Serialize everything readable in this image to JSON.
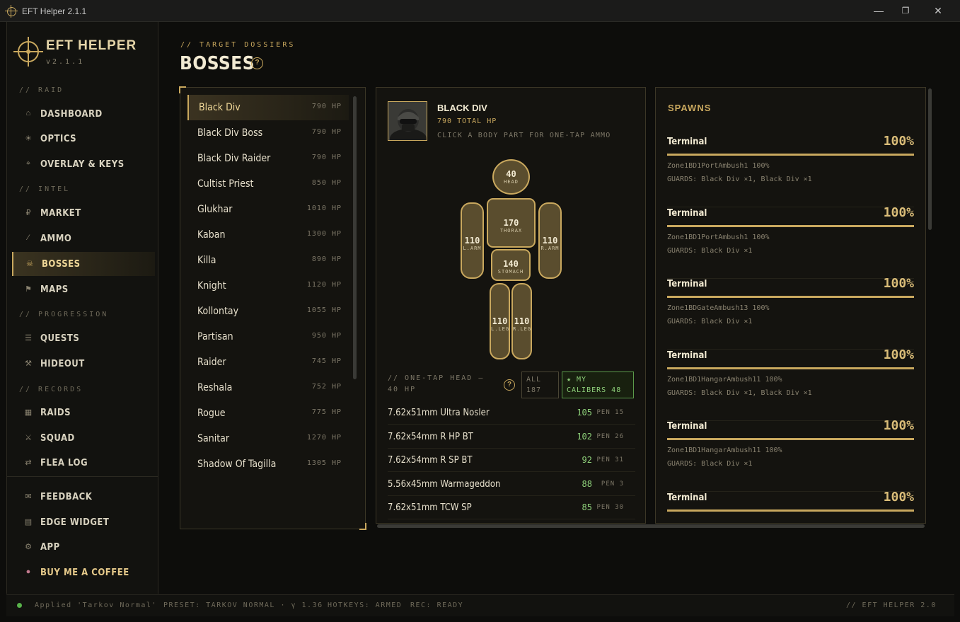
{
  "window": {
    "title": "EFT Helper 2.1.1"
  },
  "sidebar": {
    "brand": "EFT HELPER",
    "version": "v2.1.1",
    "sections": {
      "raid": "// RAID",
      "intel": "// INTEL",
      "progression": "// PROGRESSION",
      "records": "// RECORDS"
    },
    "items": [
      {
        "label": "DASHBOARD",
        "icon": "home-icon"
      },
      {
        "label": "OPTICS",
        "icon": "sun-icon"
      },
      {
        "label": "OVERLAY & KEYS",
        "icon": "crosshair-icon"
      },
      {
        "label": "MARKET",
        "icon": "ruble-icon"
      },
      {
        "label": "AMMO",
        "icon": "bullet-icon"
      },
      {
        "label": "BOSSES",
        "icon": "skull-icon"
      },
      {
        "label": "MAPS",
        "icon": "flag-icon"
      },
      {
        "label": "QUESTS",
        "icon": "list-icon"
      },
      {
        "label": "HIDEOUT",
        "icon": "tools-icon"
      },
      {
        "label": "RAIDS",
        "icon": "grid-icon"
      },
      {
        "label": "SQUAD",
        "icon": "swords-icon"
      },
      {
        "label": "FLEA LOG",
        "icon": "swap-icon"
      }
    ],
    "footer_items": [
      {
        "label": "FEEDBACK",
        "icon": "mail-icon"
      },
      {
        "label": "EDGE WIDGET",
        "icon": "widget-icon"
      },
      {
        "label": "APP",
        "icon": "gear-icon"
      },
      {
        "label": "BUY ME A COFFEE",
        "icon": "coffee-icon"
      }
    ]
  },
  "header": {
    "kicker": "// TARGET DOSSIERS",
    "title": "BOSSES",
    "help": "?"
  },
  "bosses": [
    {
      "name": "Black Div",
      "hp": "790 HP"
    },
    {
      "name": "Black Div Boss",
      "hp": "790 HP"
    },
    {
      "name": "Black Div Raider",
      "hp": "790 HP"
    },
    {
      "name": "Cultist Priest",
      "hp": "850 HP"
    },
    {
      "name": "Glukhar",
      "hp": "1010 HP"
    },
    {
      "name": "Kaban",
      "hp": "1300 HP"
    },
    {
      "name": "Killa",
      "hp": "890 HP"
    },
    {
      "name": "Knight",
      "hp": "1120 HP"
    },
    {
      "name": "Kollontay",
      "hp": "1055 HP"
    },
    {
      "name": "Partisan",
      "hp": "950 HP"
    },
    {
      "name": "Raider",
      "hp": "745 HP"
    },
    {
      "name": "Reshala",
      "hp": "752 HP"
    },
    {
      "name": "Rogue",
      "hp": "775 HP"
    },
    {
      "name": "Sanitar",
      "hp": "1270 HP"
    },
    {
      "name": "Shadow Of Tagilla",
      "hp": "1305 HP"
    }
  ],
  "detail": {
    "name": "BLACK DIV",
    "total": "790 TOTAL HP",
    "hint": "CLICK A BODY PART FOR ONE-TAP AMMO",
    "body": {
      "head": {
        "value": "40",
        "label": "HEAD"
      },
      "thorax": {
        "value": "170",
        "label": "THORAX"
      },
      "stomach": {
        "value": "140",
        "label": "STOMACH"
      },
      "larm": {
        "value": "110",
        "label": "L.ARM"
      },
      "rarm": {
        "value": "110",
        "label": "R.ARM"
      },
      "lleg": {
        "value": "110",
        "label": "L.LEG"
      },
      "rleg": {
        "value": "110",
        "label": "R.LEG"
      }
    },
    "onetap_label": "// ONE-TAP HEAD — 40 HP",
    "filter_all": "ALL",
    "filter_all_count": "187",
    "filter_my": "★ MY",
    "filter_my_label": "CALIBERS 48",
    "ammo": [
      {
        "name": "7.62x51mm Ultra Nosler",
        "damage": "105",
        "pen": "PEN 15"
      },
      {
        "name": "7.62x54mm R HP BT",
        "damage": "102",
        "pen": "PEN 26"
      },
      {
        "name": "7.62x54mm R SP BT",
        "damage": "92",
        "pen": "PEN 31"
      },
      {
        "name": "5.56x45mm Warmageddon",
        "damage": "88",
        "pen": "PEN 3"
      },
      {
        "name": "7.62x51mm TCW SP",
        "damage": "85",
        "pen": "PEN 30"
      }
    ]
  },
  "spawns": {
    "title": "SPAWNS",
    "items": [
      {
        "location": "Terminal",
        "chance": "100%",
        "zone": "Zone1BD1PortAmbush1 100%",
        "guards": "GUARDS: Black Div ×1, Black Div ×1"
      },
      {
        "location": "Terminal",
        "chance": "100%",
        "zone": "Zone1BD1PortAmbush1 100%",
        "guards": "GUARDS: Black Div ×1"
      },
      {
        "location": "Terminal",
        "chance": "100%",
        "zone": "Zone1BDGateAmbush13 100%",
        "guards": "GUARDS: Black Div ×1"
      },
      {
        "location": "Terminal",
        "chance": "100%",
        "zone": "Zone1BD1HangarAmbush11 100%",
        "guards": "GUARDS: Black Div ×1, Black Div ×1"
      },
      {
        "location": "Terminal",
        "chance": "100%",
        "zone": "Zone1BD1HangarAmbush11 100%",
        "guards": "GUARDS: Black Div ×1"
      },
      {
        "location": "Terminal",
        "chance": "100%",
        "zone": "",
        "guards": ""
      }
    ]
  },
  "status": {
    "applied": "Applied 'Tarkov Normal'",
    "preset": "PRESET: TARKOV NORMAL · γ 1.36",
    "hotkeys": "HOTKEYS: ARMED",
    "rec": "REC: READY",
    "right": "// EFT HELPER 2.0"
  },
  "colors": {
    "accent": "#c9a85e",
    "bg": "#0d0d0b",
    "panel": "#14130f",
    "good": "#8ed07a"
  }
}
